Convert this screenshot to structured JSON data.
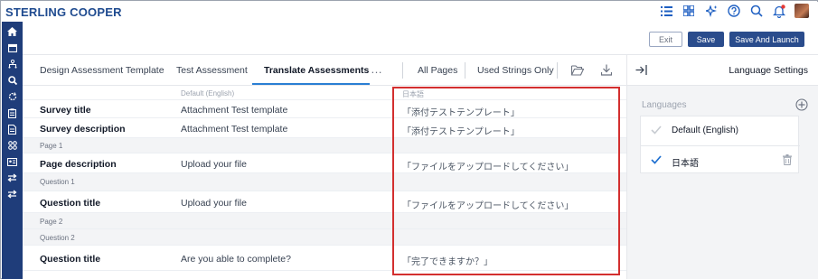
{
  "brand": "STERLING COOPER",
  "top_icons": [
    "list-icon",
    "grid-icon",
    "sparkle-icon",
    "help-icon",
    "search-icon",
    "bell-icon",
    "avatar"
  ],
  "rail_icons": [
    "home-icon",
    "calendar-icon",
    "org-icon",
    "search-icon",
    "refresh-icon",
    "clipboard-icon",
    "document-icon",
    "apps-icon",
    "id-card-icon",
    "transfer-icon",
    "swap-icon"
  ],
  "actions": {
    "exit": "Exit",
    "save": "Save",
    "save_launch": "Save And Launch"
  },
  "tabs": {
    "t1": "Design Assessment Template",
    "t2": "Test Assessment",
    "t3": "Translate Assessments",
    "more": "…",
    "all_pages": "All Pages",
    "used_strings": "Used Strings Only"
  },
  "grid": {
    "header_default": "Default (English)",
    "header_target": "日本語",
    "rows": {
      "r1": {
        "label": "Survey title",
        "source": "Attachment Test template",
        "translation": "「添付テストテンプレート」"
      },
      "r2": {
        "label": "Survey description",
        "source": "Attachment Test template",
        "translation": "「添付テストテンプレート」"
      },
      "s1": {
        "label": "Page 1"
      },
      "r3": {
        "label": "Page description",
        "source": "Upload your file",
        "translation": "「ファイルをアップロードしてください」"
      },
      "s2": {
        "label": "Question 1"
      },
      "r4": {
        "label": "Question title",
        "source": "Upload your file",
        "translation": "「ファイルをアップロードしてください」"
      },
      "s3": {
        "label": "Page 2"
      },
      "s4": {
        "label": "Question 2"
      },
      "r5": {
        "label": "Question title",
        "source": "Are you able to complete?",
        "translation": "「完了できますか？」"
      }
    }
  },
  "panel": {
    "title": "Language Settings",
    "languages_heading": "Languages",
    "languages": [
      {
        "name": "Default (English)",
        "checked": true,
        "disabled": true
      },
      {
        "name": "日本語",
        "checked": true,
        "disabled": false
      }
    ]
  },
  "colors": {
    "accent": "#2a4c8c",
    "rail": "#1f3d7a",
    "highlight": "#d32f2f",
    "tab_underline": "#2a7fd4"
  }
}
